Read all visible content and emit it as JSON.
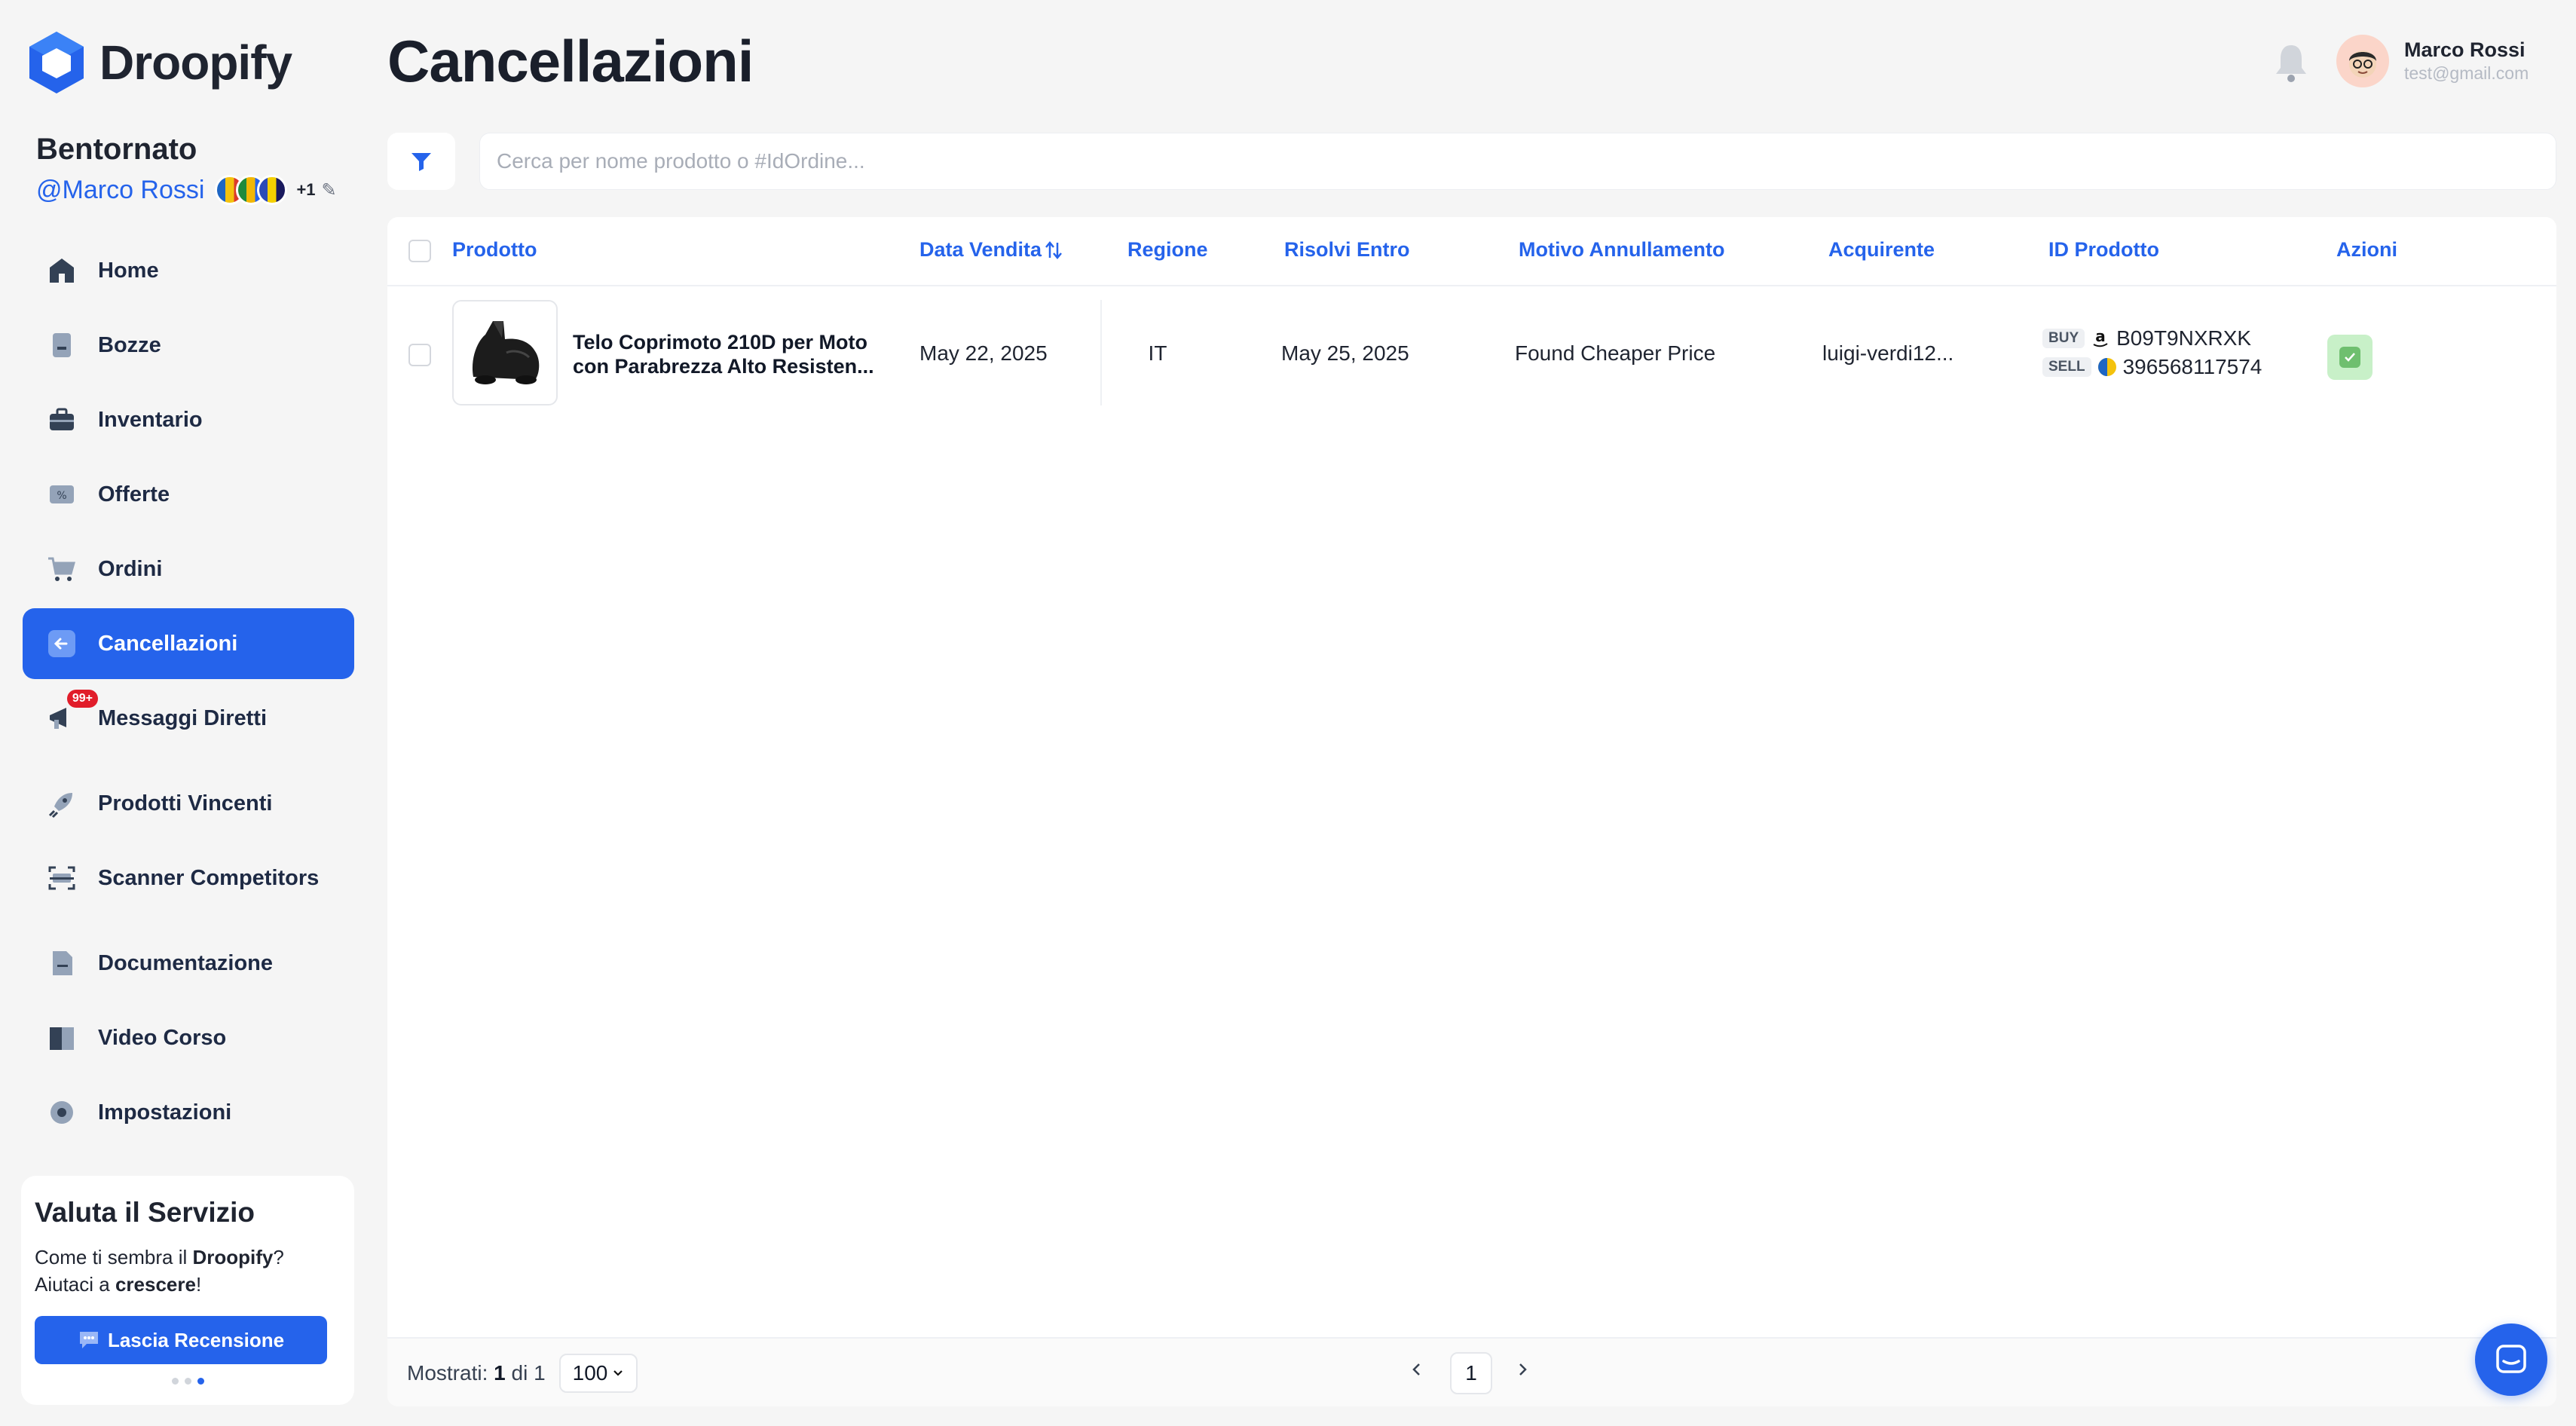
{
  "app": {
    "name": "Droopify"
  },
  "sidebar": {
    "welcome": "Bentornato",
    "handle": "@Marco Rossi",
    "extra_count": "+1",
    "items": [
      {
        "label": "Home",
        "icon": "home-icon"
      },
      {
        "label": "Bozze",
        "icon": "draft-icon"
      },
      {
        "label": "Inventario",
        "icon": "briefcase-icon"
      },
      {
        "label": "Offerte",
        "icon": "ticket-icon"
      },
      {
        "label": "Ordini",
        "icon": "cart-icon"
      },
      {
        "label": "Cancellazioni",
        "icon": "arrow-left-icon",
        "active": true
      },
      {
        "label": "Messaggi Diretti",
        "icon": "megaphone-icon",
        "badge": "99+"
      },
      {
        "label": "Prodotti Vincenti",
        "icon": "rocket-icon"
      },
      {
        "label": "Scanner Competitors",
        "icon": "scanner-icon"
      },
      {
        "label": "Documentazione",
        "icon": "document-icon"
      },
      {
        "label": "Video Corso",
        "icon": "book-icon"
      },
      {
        "label": "Impostazioni",
        "icon": "gear-icon"
      }
    ],
    "review": {
      "title": "Valuta il Servizio",
      "line1_pre": "Come ti sembra il ",
      "line1_bold": "Droopify",
      "line1_post": "?",
      "line2_pre": "Aiutaci a ",
      "line2_bold": "crescere",
      "line2_post": "!",
      "button": "Lascia Recensione"
    }
  },
  "header": {
    "title": "Cancellazioni",
    "user_name": "Marco Rossi",
    "user_email": "test@gmail.com"
  },
  "search": {
    "placeholder": "Cerca per nome prodotto o #IdOrdine...",
    "value": ""
  },
  "table": {
    "columns": [
      "Prodotto",
      "Data Vendita",
      "Regione",
      "Risolvi Entro",
      "Motivo Annullamento",
      "Acquirente",
      "ID Prodotto",
      "Azioni"
    ],
    "rows": [
      {
        "product_line1": "Telo Coprimoto 210D per Moto",
        "product_line2": "con Parabrezza Alto Resisten...",
        "sale_date": "May 22, 2025",
        "region": "IT",
        "resolve_by": "May 25, 2025",
        "reason": "Found Cheaper Price",
        "buyer": "luigi-verdi12...",
        "buy_tag": "BUY",
        "buy_id": "B09T9NXRXK",
        "sell_tag": "SELL",
        "sell_id": "396568117574"
      }
    ]
  },
  "footer": {
    "shown_label": "Mostrati:",
    "shown_count": "1",
    "shown_of": "di 1",
    "per_page": "100",
    "current_page": "1"
  },
  "colors": {
    "accent": "#2563eb",
    "badge": "#e11d2a",
    "action_bg": "#c8f0c8"
  }
}
